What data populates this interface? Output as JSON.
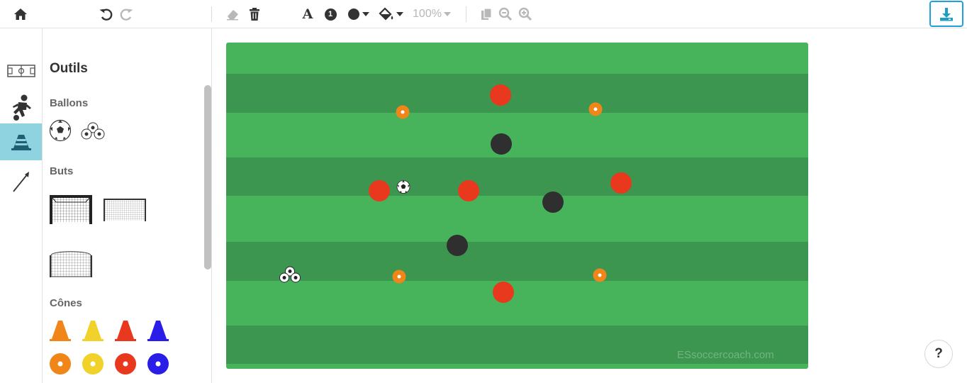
{
  "toolbar": {
    "home_icon": "home-icon",
    "undo_icon": "undo-icon",
    "redo_icon": "redo-icon",
    "eraser_icon": "eraser-icon",
    "trash_icon": "trash-icon",
    "font_label": "A",
    "number_label": "1",
    "zoom_value": "100%",
    "download_icon": "download-icon"
  },
  "rail": [
    "field-icon",
    "player-icon",
    "cone-icon",
    "arrow-icon"
  ],
  "panel": {
    "title": "Outils",
    "sections": {
      "balls": "Ballons",
      "goals": "Buts",
      "cones": "Cônes"
    },
    "cone_colors": [
      "#f08519",
      "#f0d22a",
      "#e8381e",
      "#2a1de8"
    ]
  },
  "field": {
    "watermark": "ESsoccercoach.com",
    "colors": {
      "light": "#47b45c",
      "dark": "#3c9650",
      "red": "#e8381e",
      "black": "#2f2f2f",
      "cone": "#f08519"
    }
  },
  "help_label": "?"
}
